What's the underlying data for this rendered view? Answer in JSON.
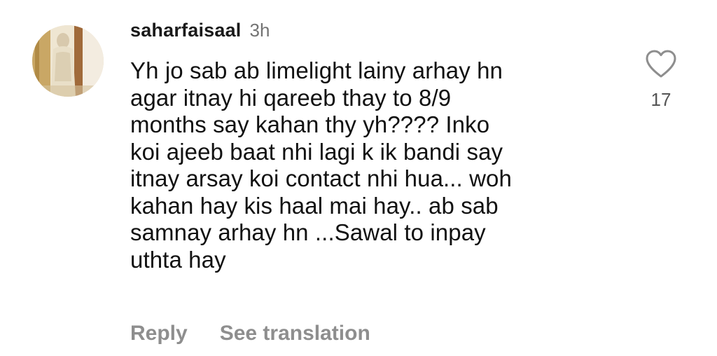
{
  "comment": {
    "username": "saharfaisaal",
    "time": "3h",
    "avatar_icon": "profile-photo",
    "text": "Yh jo sab ab limelight lainy arhay hn\nagar itnay hi qareeb thay to 8/9\nmonths say kahan thy yh???? Inko\nkoi ajeeb baat nhi lagi k ik bandi say\nitnay arsay koi contact nhi hua... woh\nkahan hay kis haal mai hay.. ab sab\nsamnay arhay hn ...Sawal to inpay\nuthta hay",
    "actions": {
      "reply": "Reply",
      "see_translation": "See translation"
    },
    "like": {
      "icon": "heart-outline",
      "count": "17"
    }
  },
  "colors": {
    "text": "#111111",
    "muted": "#8e8e8e",
    "timestamp": "#737373"
  }
}
